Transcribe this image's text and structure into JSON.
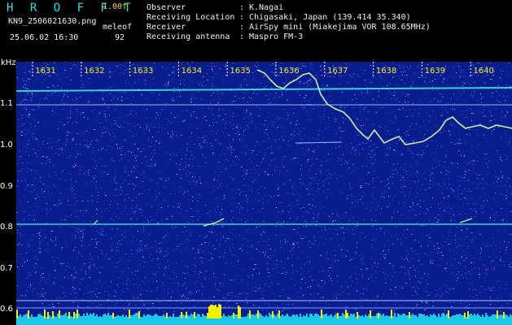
{
  "header": {
    "brand": "H R O F F T",
    "version": "1.00f",
    "file_name": "KN9_2506021630.png",
    "mode": "meleof",
    "datetime": "25.06.02 16:30",
    "count": "92",
    "info": [
      {
        "label": "Observer",
        "value": "K.Nagai"
      },
      {
        "label": "Receiving Location",
        "value": "Chigasaki, Japan (139.414 35.340)"
      },
      {
        "label": "Receiver",
        "value": "AirSpy mini (Miakejima VOR 108.65MHz)"
      },
      {
        "label": "Receiving antenna",
        "value": "Maspro FM-3"
      }
    ]
  },
  "spectrogram": {
    "y_unit": "kHz",
    "y_ticks": [
      "1.1",
      "1.0",
      "0.9",
      "0.8",
      "0.7",
      "0.6"
    ],
    "time_ticks": [
      "1631",
      "1632",
      "1633",
      "1634",
      "1635",
      "1636",
      "1637",
      "1638",
      "1639",
      "1640"
    ],
    "colors": {
      "background": "#0a1d8f",
      "noise": "#2a6cff",
      "carrier": "#38d0d8",
      "meteor_trace": "#c8f0a0",
      "bottom_bar": "#18c8e8",
      "peak": "#f0f000",
      "tick_label": "#f0f020"
    }
  }
}
